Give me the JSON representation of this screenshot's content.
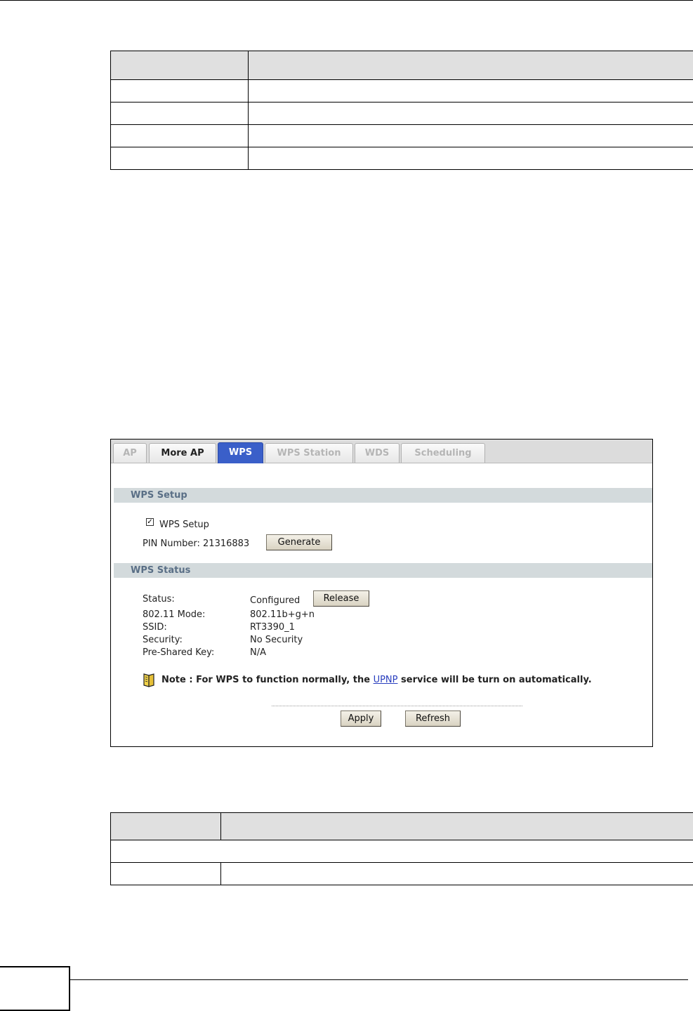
{
  "top_table": {
    "header": [
      "",
      ""
    ],
    "rows": [
      [
        "",
        ""
      ],
      [
        "",
        ""
      ],
      [
        "",
        ""
      ],
      [
        "",
        ""
      ]
    ]
  },
  "screenshot": {
    "tabs": [
      {
        "label": "AP",
        "state": "disabled"
      },
      {
        "label": "More AP",
        "state": "normal"
      },
      {
        "label": "WPS",
        "state": "active"
      },
      {
        "label": "WPS Station",
        "state": "disabled"
      },
      {
        "label": "WDS",
        "state": "disabled"
      },
      {
        "label": "Scheduling",
        "state": "disabled"
      }
    ],
    "wps_setup": {
      "title": "WPS Setup",
      "checkbox_label": "WPS Setup",
      "checkbox_checked": true,
      "pin_label": "PIN Number: 21316883",
      "generate_label": "Generate"
    },
    "wps_status": {
      "title": "WPS Status",
      "rows": [
        {
          "label": "Status:",
          "value": "Configured"
        },
        {
          "label": "802.11 Mode:",
          "value": "802.11b+g+n"
        },
        {
          "label": "SSID:",
          "value": "RT3390_1"
        },
        {
          "label": "Security:",
          "value": "No Security"
        },
        {
          "label": "Pre-Shared Key:",
          "value": "N/A"
        }
      ],
      "release_label": "Release"
    },
    "note": {
      "prefix": "Note : For WPS to function normally, the ",
      "link": "UPNP",
      "suffix": " service will be turn on automatically.",
      "icon": "note-icon"
    },
    "buttons": {
      "apply": "Apply",
      "refresh": "Refresh"
    }
  },
  "bottom_table": {
    "header": [
      "",
      ""
    ],
    "rows": [
      [
        ""
      ],
      [
        "",
        ""
      ]
    ]
  },
  "colors": {
    "active_tab": "#3a5fc9",
    "section_bar": "#d3dadc",
    "section_text": "#5a6f86",
    "link": "#2a3fbf"
  }
}
